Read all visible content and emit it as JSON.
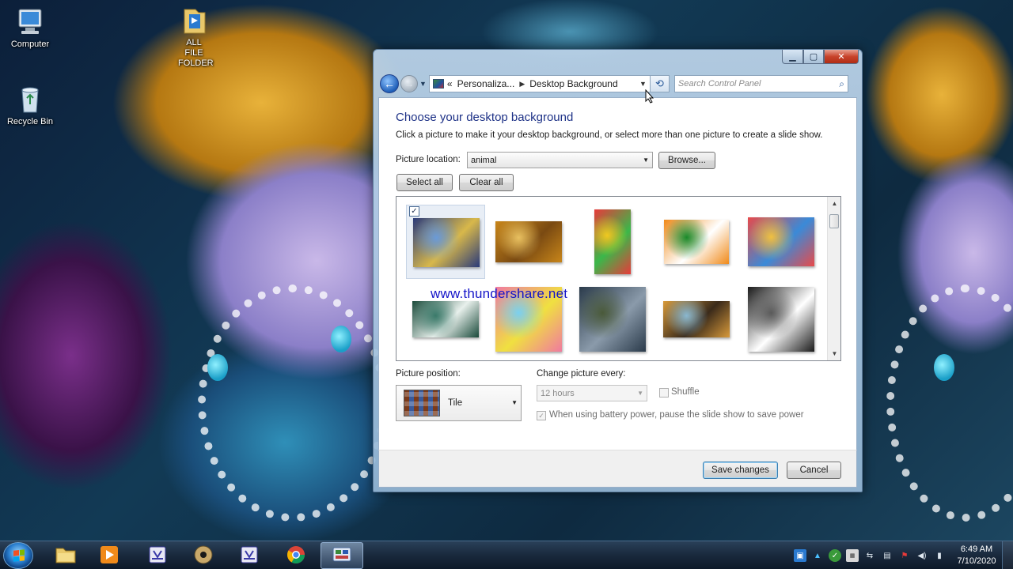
{
  "desktop": {
    "icons": [
      {
        "label": "Computer",
        "icon": "computer-icon"
      },
      {
        "label": "ALL FILE FOLDER",
        "icon": "folder-icon"
      },
      {
        "label": "Recycle Bin",
        "icon": "recycle-bin-icon"
      }
    ]
  },
  "window": {
    "breadcrumb": {
      "prefix": "«",
      "parent": "Personaliza...",
      "current": "Desktop Background"
    },
    "search_placeholder": "Search Control Panel",
    "title": "Choose your desktop background",
    "subtitle": "Click a picture to make it your desktop background, or select more than one picture to create a slide show.",
    "picture_location_label": "Picture location:",
    "picture_location_value": "animal",
    "browse_label": "Browse...",
    "select_all_label": "Select all",
    "clear_all_label": "Clear all",
    "thumbnails": [
      {
        "name": "thumb-deity-painting",
        "checked": true,
        "colors": [
          "#2a3a7a",
          "#d8b84a",
          "#6a9ad8"
        ]
      },
      {
        "name": "thumb-autumn-road",
        "checked": false,
        "colors": [
          "#c8861a",
          "#7a4a12",
          "#e8c060"
        ]
      },
      {
        "name": "thumb-jelly-beans",
        "checked": false,
        "colors": [
          "#e83a3a",
          "#3ab84a",
          "#f0c820"
        ]
      },
      {
        "name": "thumb-tricolor-flag",
        "checked": false,
        "colors": [
          "#f08a1a",
          "#ffffff",
          "#1a8a2a"
        ]
      },
      {
        "name": "thumb-goddess-lotus",
        "checked": false,
        "colors": [
          "#e84a4a",
          "#3a8ad8",
          "#f0c040"
        ]
      },
      {
        "name": "thumb-white-feather",
        "checked": false,
        "colors": [
          "#1a4a3a",
          "#e8f0ec",
          "#3a7a6a"
        ]
      },
      {
        "name": "thumb-candy-hearts",
        "checked": false,
        "colors": [
          "#f07aa0",
          "#f0e040",
          "#7ad0f0"
        ]
      },
      {
        "name": "thumb-dark-warrior",
        "checked": false,
        "colors": [
          "#2a3a4a",
          "#8a9aaa",
          "#4a5a3a"
        ]
      },
      {
        "name": "thumb-leopard",
        "checked": false,
        "colors": [
          "#d89a3a",
          "#3a2a1a",
          "#8ab8d0"
        ]
      },
      {
        "name": "thumb-wrist-watch",
        "checked": false,
        "colors": [
          "#1a1a1a",
          "#ffffff",
          "#5a5a5a"
        ]
      }
    ],
    "watermark": "www.thundershare.net",
    "picture_position_label": "Picture position:",
    "picture_position_value": "Tile",
    "change_picture_label": "Change picture every:",
    "interval_value": "12 hours",
    "shuffle_label": "Shuffle",
    "battery_label": "When using battery power, pause the slide show to save power",
    "save_label": "Save changes",
    "cancel_label": "Cancel"
  },
  "taskbar": {
    "pinned": [
      {
        "name": "explorer-taskbar-button",
        "icon": "folder-icon"
      },
      {
        "name": "media-player-taskbar-button",
        "icon": "play-icon"
      },
      {
        "name": "app-taskbar-button-3",
        "icon": "app-icon"
      },
      {
        "name": "app-taskbar-button-4",
        "icon": "disc-icon"
      },
      {
        "name": "app-taskbar-button-5",
        "icon": "app-icon"
      },
      {
        "name": "chrome-taskbar-button",
        "icon": "chrome-icon"
      },
      {
        "name": "control-panel-taskbar-button",
        "icon": "control-panel-icon"
      }
    ],
    "clock_time": "6:49 AM",
    "clock_date": "7/10/2020"
  }
}
